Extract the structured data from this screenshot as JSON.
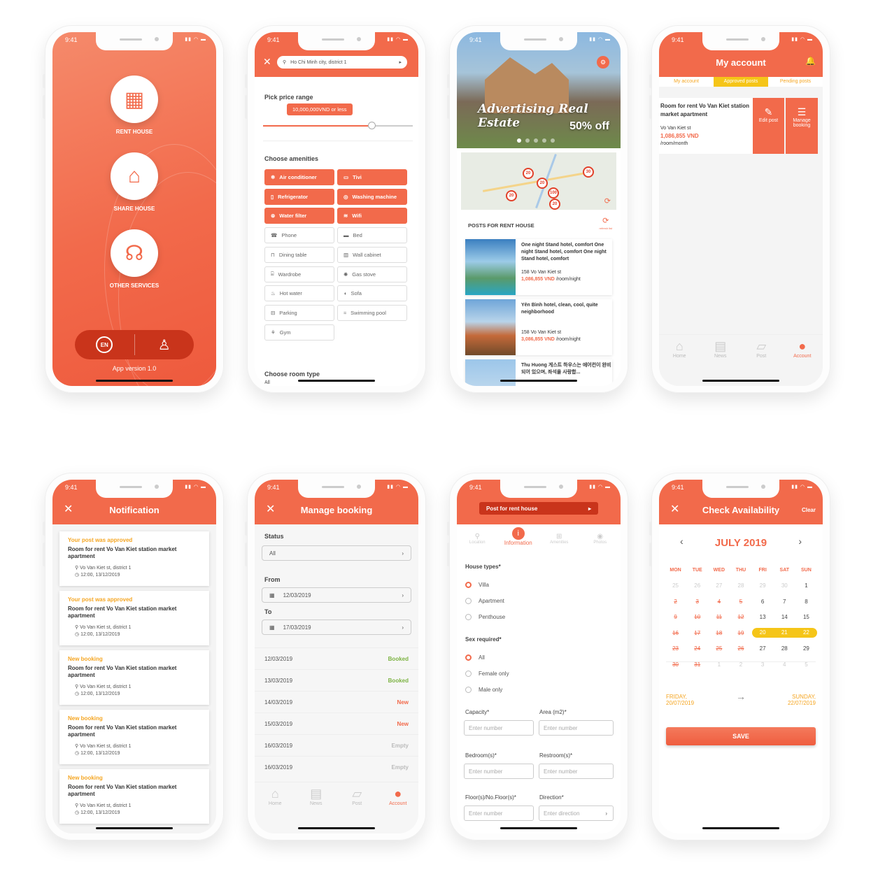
{
  "status_time": "9:41",
  "app": {
    "items": [
      {
        "label": "RENT HOUSE"
      },
      {
        "label": "SHARE HOUSE"
      },
      {
        "label": "OTHER SERVICES"
      }
    ],
    "lang": "EN",
    "version": "App version 1.0"
  },
  "filter": {
    "location": "Ho Chi Minh city, district 1",
    "price_title": "Pick price range",
    "price_value": "10,000,000VND or less",
    "amen_title": "Choose amenities",
    "amenities": [
      "Air conditioner",
      "Tivi",
      "Refrigerator",
      "Washing machine",
      "Water filter",
      "Wifi",
      "Phone",
      "Bed",
      "Dining table",
      "Wall cabinet",
      "Wardrobe",
      "Gas stove",
      "Hot water",
      "Sofa",
      "Parking",
      "Swimming pool",
      "Gym"
    ],
    "room_title": "Choose room type",
    "room_all": "All"
  },
  "home": {
    "banner1": "Advertising Real Estate",
    "banner2": "50% off",
    "map_pins": [
      "20",
      "20",
      "20",
      "30",
      "100",
      "20"
    ],
    "posts_title": "POSTS FOR RENT HOUSE",
    "refresh": "refresh list",
    "posts": [
      {
        "title": "One night Stand hotel, comfort One night Stand hotel, comfort One night Stand hotel, comfort",
        "addr": "158 Vo Van Kiet st",
        "price": "1,086,855 VND",
        "unit": "/room/night"
      },
      {
        "title": "Yên Bình hotel, clean, cool, quite neighborhood",
        "addr": "158 Vo Van Kiet st",
        "price": "3,086,855 VND",
        "unit": "/room/night"
      },
      {
        "title": "Thu Huong 게스트 하우스는 에어컨이 완비되어 있으며, 좌석을 사랑합..."
      }
    ]
  },
  "account": {
    "title": "My account",
    "tabs": [
      "My account",
      "Approved posts",
      "Pending posts"
    ],
    "card_title": "Room for rent Vo Van Kiet station market apartment",
    "card_addr": "Vo Van Kiet st",
    "card_price": "1,086,855 VND",
    "card_unit": "/room/month",
    "edit": "Edit post",
    "manage": "Manage booking"
  },
  "nav": [
    "Home",
    "News",
    "Post",
    "Account"
  ],
  "notif": {
    "title": "Notification",
    "items": [
      {
        "type": "Your post was approved",
        "body": "Room for rent Vo Van Kiet station market apartment",
        "addr": "Vo Van Kiet st, district 1",
        "time": "12:00, 13/12/2019"
      },
      {
        "type": "Your post was approved",
        "body": "Room for rent Vo Van Kiet station market apartment",
        "addr": "Vo Van Kiet st, district 1",
        "time": "12:00, 13/12/2019"
      },
      {
        "type": "New booking",
        "body": "Room for rent Vo Van Kiet station market apartment",
        "addr": "Vo Van Kiet st, district 1",
        "time": "12:00, 13/12/2019"
      },
      {
        "type": "New booking",
        "body": "Room for rent Vo Van Kiet station market apartment",
        "addr": "Vo Van Kiet st, district 1",
        "time": "12:00, 13/12/2019"
      },
      {
        "type": "New booking",
        "body": "Room for rent Vo Van Kiet station market apartment",
        "addr": "Vo Van Kiet st, district 1",
        "time": "12:00, 13/12/2019"
      }
    ]
  },
  "booking": {
    "title": "Manage booking",
    "status_lbl": "Status",
    "status_val": "All",
    "from_lbl": "From",
    "from_val": "12/03/2019",
    "to_lbl": "To",
    "to_val": "17/03/2019",
    "rows": [
      {
        "date": "12/03/2019",
        "state": "Booked",
        "color": "#7cb342"
      },
      {
        "date": "13/03/2019",
        "state": "Booked",
        "color": "#7cb342"
      },
      {
        "date": "14/03/2019",
        "state": "New",
        "color": "#f26a4b"
      },
      {
        "date": "15/03/2019",
        "state": "New",
        "color": "#f26a4b"
      },
      {
        "date": "16/03/2019",
        "state": "Empty",
        "color": "#bbbbbb"
      },
      {
        "date": "16/03/2019",
        "state": "Empty",
        "color": "#bbbbbb"
      }
    ]
  },
  "postform": {
    "title": "Post for rent house",
    "steps": [
      "Location",
      "Information",
      "Amenities",
      "Photos"
    ],
    "house_lbl": "House types*",
    "house": [
      "Villa",
      "Apartment",
      "Penthouse"
    ],
    "sex_lbl": "Sex required*",
    "sex": [
      "All",
      "Female only",
      "Male only"
    ],
    "capacity": "Capacity*",
    "area": "Area (m2)*",
    "bedroom": "Bedroom(s)*",
    "restroom": "Restroom(s)*",
    "floor": "Floor(s)/No.Floor(s)*",
    "direction": "Direction*",
    "ph_num": "Enter number",
    "ph_dir": "Enter direction"
  },
  "calendar": {
    "title": "Check Availability",
    "clear": "Clear",
    "month": "JULY 2019",
    "days": [
      "MON",
      "TUE",
      "WED",
      "THU",
      "FRI",
      "SAT",
      "SUN"
    ],
    "cells": [
      [
        "25",
        "26",
        "27",
        "28",
        "29",
        "30",
        "1"
      ],
      [
        "2",
        "3",
        "4",
        "5",
        "6",
        "7",
        "8"
      ],
      [
        "9",
        "10",
        "11",
        "12",
        "13",
        "14",
        "15"
      ],
      [
        "16",
        "17",
        "18",
        "19",
        "20",
        "21",
        "22"
      ],
      [
        "23",
        "24",
        "25",
        "26",
        "27",
        "28",
        "29"
      ],
      [
        "30",
        "31",
        "1",
        "2",
        "3",
        "4",
        "5"
      ]
    ],
    "from": "FRIDAY, 20/07/2019",
    "to": "SUNDAY, 22/07/2019",
    "save": "SAVE"
  },
  "colors": {
    "accent": "#f26a4b",
    "yellow": "#f5c518",
    "green": "#7cb342"
  }
}
